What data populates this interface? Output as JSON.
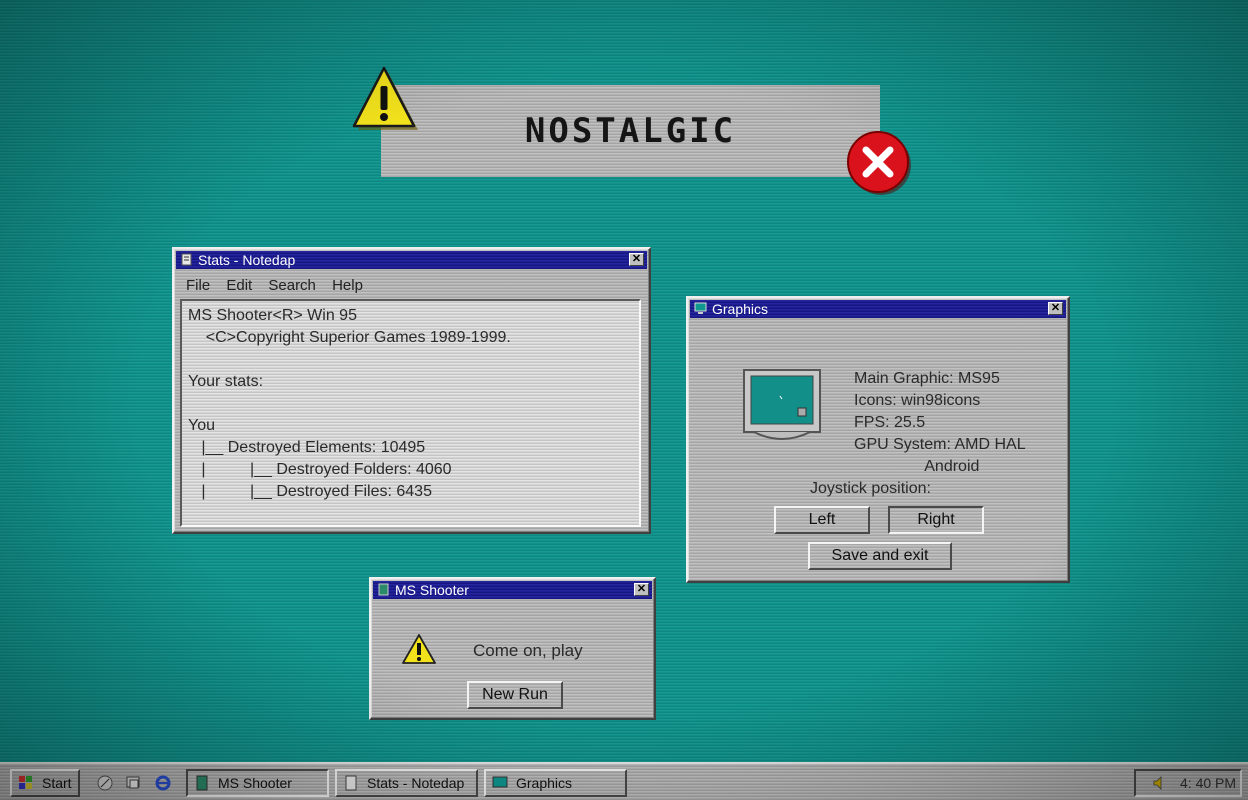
{
  "banner": {
    "title": "NOSTALGIC"
  },
  "notepad": {
    "title": "Stats - Notedap",
    "menu": [
      "File",
      "Edit",
      "Search",
      "Help"
    ],
    "lines": [
      "MS Shooter<R> Win 95",
      "    <C>Copyright Superior Games 1989-1999.",
      "",
      "Your stats:",
      "",
      "You",
      "   |__ Destroyed Elements: 10495",
      "   |          |__ Destroyed Folders: 4060",
      "   |          |__ Destroyed Files: 6435"
    ]
  },
  "graphics": {
    "title": "Graphics",
    "info": [
      "Main Graphic: MS95",
      "Icons: win98icons",
      "FPS: 25.5",
      "GPU System: AMD HAL",
      "                Android"
    ],
    "joystick_label": "Joystick position:",
    "left_label": "Left",
    "right_label": "Right",
    "save_label": "Save and exit"
  },
  "shooter": {
    "title": "MS Shooter",
    "message": "Come on, play",
    "new_run_label": "New Run"
  },
  "taskbar": {
    "start_label": "Start",
    "tasks": [
      "MS Shooter",
      "Stats - Notedap",
      "Graphics"
    ],
    "clock": "4: 40 PM"
  },
  "colors": {
    "desktop": "#0f9790",
    "titlebar": "#1a1a9a",
    "window": "#bdbdbd",
    "warning": "#f2e21c",
    "error": "#d9121b"
  }
}
